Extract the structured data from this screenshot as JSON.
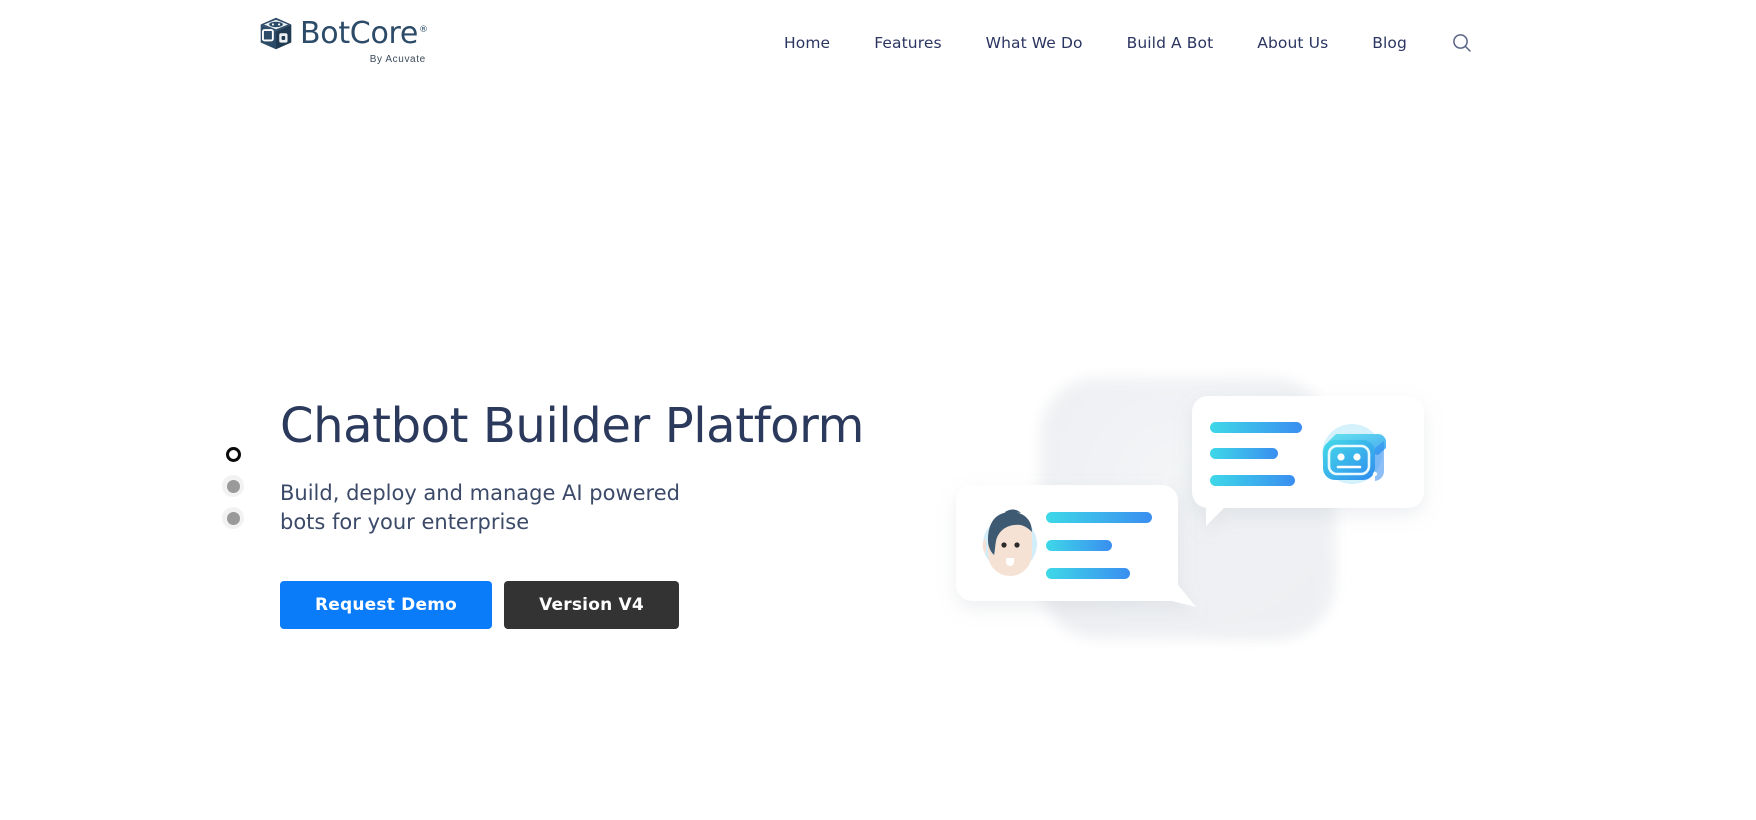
{
  "header": {
    "logo": {
      "name": "BotCore",
      "trademark": "®",
      "tagline": "By Acuvate",
      "icon": "botcore-cube-logo"
    },
    "nav_items": [
      {
        "label": "Home",
        "name": "home"
      },
      {
        "label": "Features",
        "name": "features"
      },
      {
        "label": "What We Do",
        "name": "what-we-do"
      },
      {
        "label": "Build A Bot",
        "name": "build-a-bot"
      },
      {
        "label": "About Us",
        "name": "about-us"
      },
      {
        "label": "Blog",
        "name": "blog"
      }
    ],
    "search_icon": "search-icon"
  },
  "hero": {
    "title": "Chatbot Builder Platform",
    "subtitle": "Build, deploy and manage AI powered bots for your enterprise",
    "primary_button": "Request Demo",
    "secondary_button": "Version V4",
    "carousel": {
      "total": 3,
      "active_index": 0
    },
    "illustration": {
      "name": "chat-bubbles-illustration",
      "bot_avatar": "bot-face-icon",
      "user_avatar": "user-face-avatar",
      "bubble_top_lines": 3,
      "bubble_bottom_lines": 3
    }
  },
  "colors": {
    "accent_blue": "#0a7cfa",
    "dark_button": "#333333",
    "navy_text": "#2b3a5c",
    "nav_text": "#2b3561",
    "logo_blue": "#2c4b68",
    "gradient_start": "#3ed8e8",
    "gradient_end": "#3a8ef0",
    "dot_inactive": "#9a9a9a",
    "page_background": "#ffffff"
  }
}
